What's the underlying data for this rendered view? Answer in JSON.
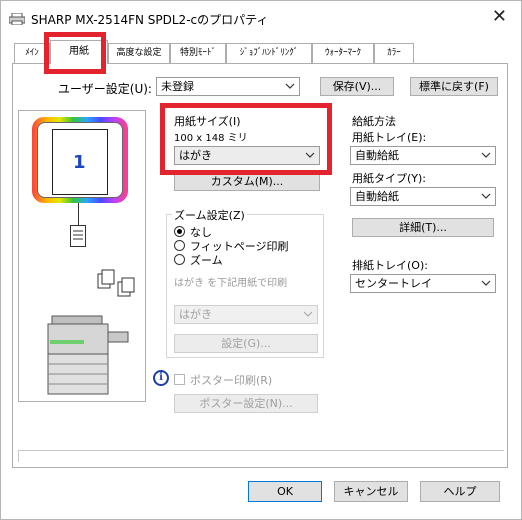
{
  "window": {
    "title": "SHARP MX-2514FN SPDL2-cのプロパティ",
    "close_symbol": "✕"
  },
  "tabs": [
    {
      "label": "ﾒｲﾝ"
    },
    {
      "label": "用紙",
      "active": true
    },
    {
      "label": "高度な設定"
    },
    {
      "label": "特別ﾓｰﾄﾞ"
    },
    {
      "label": "ｼﾞｮﾌﾞﾊﾝﾄﾞﾘﾝｸﾞ"
    },
    {
      "label": "ｳｫｰﾀｰﾏｰｸ"
    },
    {
      "label": "ｶﾗｰ"
    }
  ],
  "user_settings": {
    "label": "ユーザー設定(U):",
    "value": "未登録",
    "save_button": "保存(V)...",
    "reset_button": "標準に戻す(F)"
  },
  "preview": {
    "page_number": "1"
  },
  "paper_size": {
    "title": "用紙サイズ(I)",
    "dimensions": "100 x 148 ミリ",
    "value": "はがき",
    "custom_button": "カスタム(M)..."
  },
  "zoom": {
    "title": "ズーム設定(Z)",
    "options": [
      "なし",
      "フィットページ印刷",
      "ズーム"
    ],
    "selected": 0,
    "fit_label": "はがき を下記用紙で印刷",
    "fit_value": "はがき",
    "settings_button": "設定(G)..."
  },
  "feed": {
    "title": "給紙方法",
    "tray_label": "用紙トレイ(E):",
    "tray_value": "自動給紙",
    "type_label": "用紙タイプ(Y):",
    "type_value": "自動給紙",
    "detail_button": "詳細(T)..."
  },
  "output": {
    "label": "排紙トレイ(O):",
    "value": "センタートレイ"
  },
  "poster": {
    "checkbox_label": "ポスター印刷(R)",
    "settings_button": "ポスター設定(N)...",
    "info_symbol": "i"
  },
  "footer": {
    "ok": "OK",
    "cancel": "キャンセル",
    "help": "ヘルプ"
  },
  "colors": {
    "highlight": "#e3232e",
    "selection": "#e5e5e5"
  }
}
